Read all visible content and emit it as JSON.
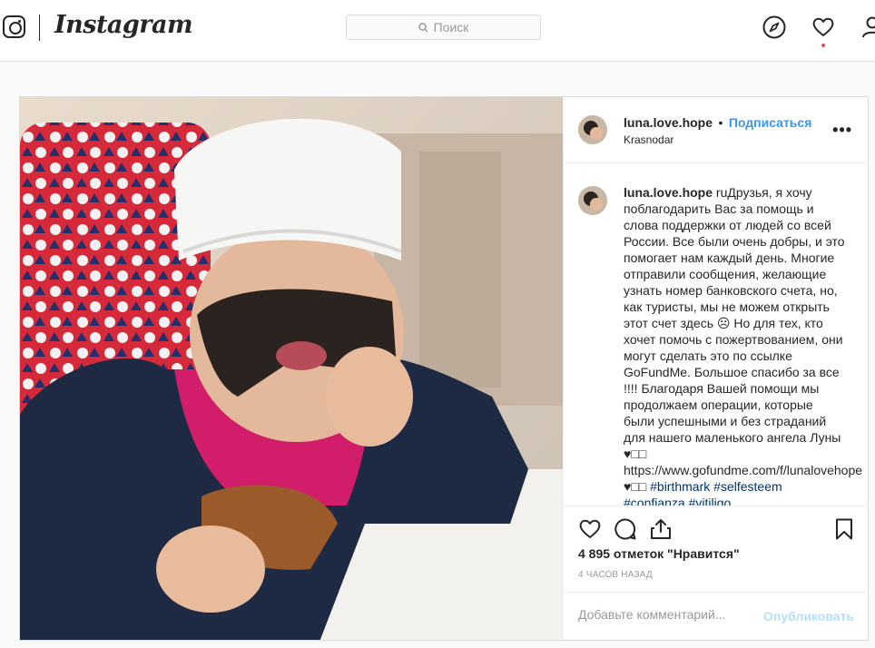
{
  "app": {
    "wordmark": "Instagram"
  },
  "search": {
    "placeholder": "Поиск",
    "icon": "search-icon"
  },
  "nav": {
    "icons": [
      "explore-compass-icon",
      "activity-heart-icon",
      "profile-user-icon"
    ],
    "notification_color": "#ed4956"
  },
  "post": {
    "image_description_icon": "photo",
    "author": {
      "username": "luna.love.hope",
      "separator": "•",
      "follow_label": "Подписаться",
      "location": "Krasnodar"
    },
    "caption": {
      "username": "luna.love.hope",
      "text": "ruДрузья, я хочу поблагодарить Вас за помощь и слова поддержки от людей со всей России. Все были очень добры, и это помогает нам каждый день. Многие отправили сообщения, желающие узнать номер банковского счета, но, как туристы, мы не можем открыть этот счет здесь ☹ Но для тех, кто хочет помочь с пожертвованием, они могут сделать это по ссылке GoFundMe. Большое спасибо за все !!!! Благодаря Вашей помощи мы продолжаем операции, которые были успешными и без страданий для нашего маленького ангела Луны ♥□□ https://www.gofundme.com/f/lunalovehope ♥□□",
      "hashtags": [
        "#birthmark",
        "#selfesteem",
        "#confianza",
        "#vitiligo"
      ]
    },
    "likes": "4 895 отметок \"Нравится\"",
    "time": "4 часов назад",
    "comment": {
      "placeholder": "Добавьте комментарий...",
      "publish_label": "Опубликовать"
    },
    "more_label": "•••"
  },
  "colors": {
    "link_blue": "#3897f0",
    "hashtag": "#003569",
    "border": "#dbdbdb"
  }
}
